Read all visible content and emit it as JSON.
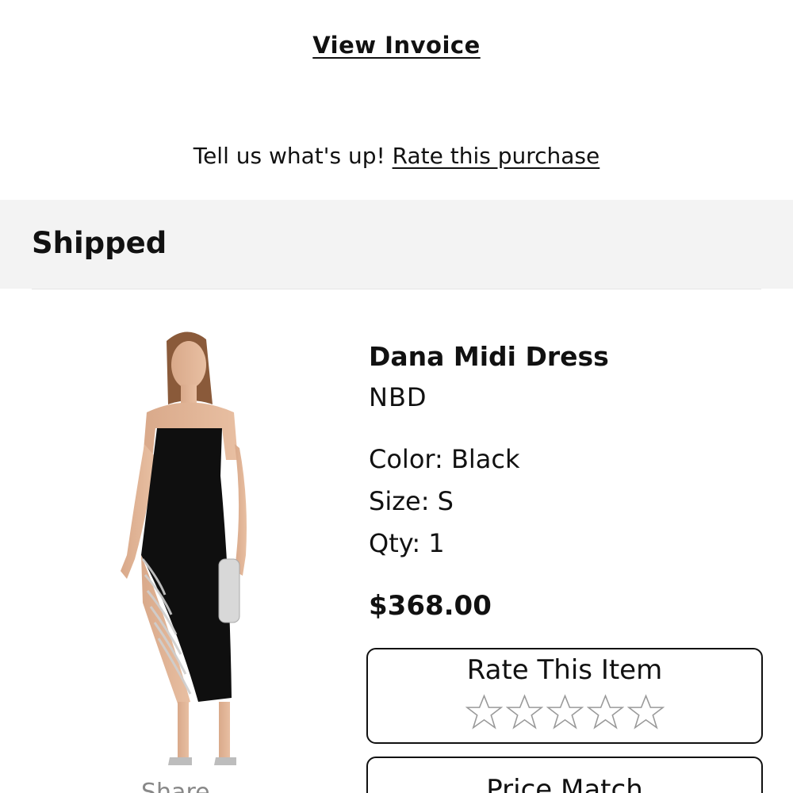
{
  "header": {
    "view_invoice": "View Invoice",
    "rate_prompt": "Tell us what's up!",
    "rate_link": "Rate this purchase"
  },
  "order_status": {
    "label": "Shipped",
    "background": "#f3f3f3"
  },
  "product": {
    "name": "Dana Midi Dress",
    "brand": "NBD",
    "color": "Color: Black",
    "size": "Size: S",
    "qty": "Qty: 1",
    "price": "$368.00",
    "image_icon": "product-photo",
    "share_label": "Share"
  },
  "rating": {
    "title": "Rate This Item",
    "stars_total": 5,
    "stars_filled": 0
  },
  "price_match": {
    "label": "Price Match"
  }
}
